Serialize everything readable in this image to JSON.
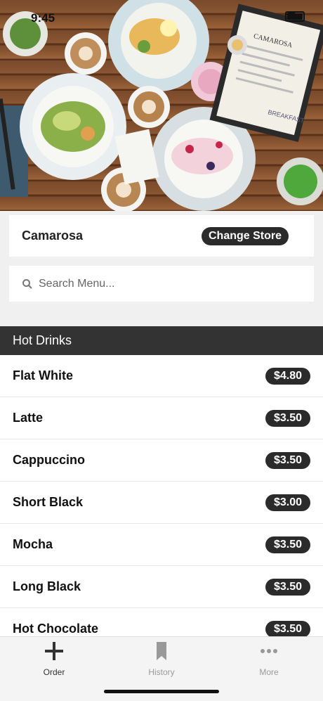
{
  "status": {
    "time": "9:45"
  },
  "store": {
    "name": "Camarosa",
    "change_label": "Change Store"
  },
  "search": {
    "placeholder": "Search Menu..."
  },
  "category": {
    "title": "Hot Drinks"
  },
  "menu": [
    {
      "name": "Flat White",
      "price": "$4.80"
    },
    {
      "name": "Latte",
      "price": "$3.50"
    },
    {
      "name": "Cappuccino",
      "price": "$3.50"
    },
    {
      "name": "Short Black",
      "price": "$3.00"
    },
    {
      "name": "Mocha",
      "price": "$3.50"
    },
    {
      "name": "Long Black",
      "price": "$3.50"
    },
    {
      "name": "Hot Chocolate",
      "price": "$3.50"
    }
  ],
  "tabs": [
    {
      "label": "Order",
      "icon": "plus-icon",
      "active": true
    },
    {
      "label": "History",
      "icon": "bookmark-icon",
      "active": false
    },
    {
      "label": "More",
      "icon": "more-dots-icon",
      "active": false
    }
  ],
  "hero": {
    "menu_brand": "CAMAROSA",
    "menu_section": "BREAKFAST"
  },
  "colors": {
    "dark": "#2b2b2b",
    "category_bg": "#333333",
    "background": "#f0f0f0"
  }
}
